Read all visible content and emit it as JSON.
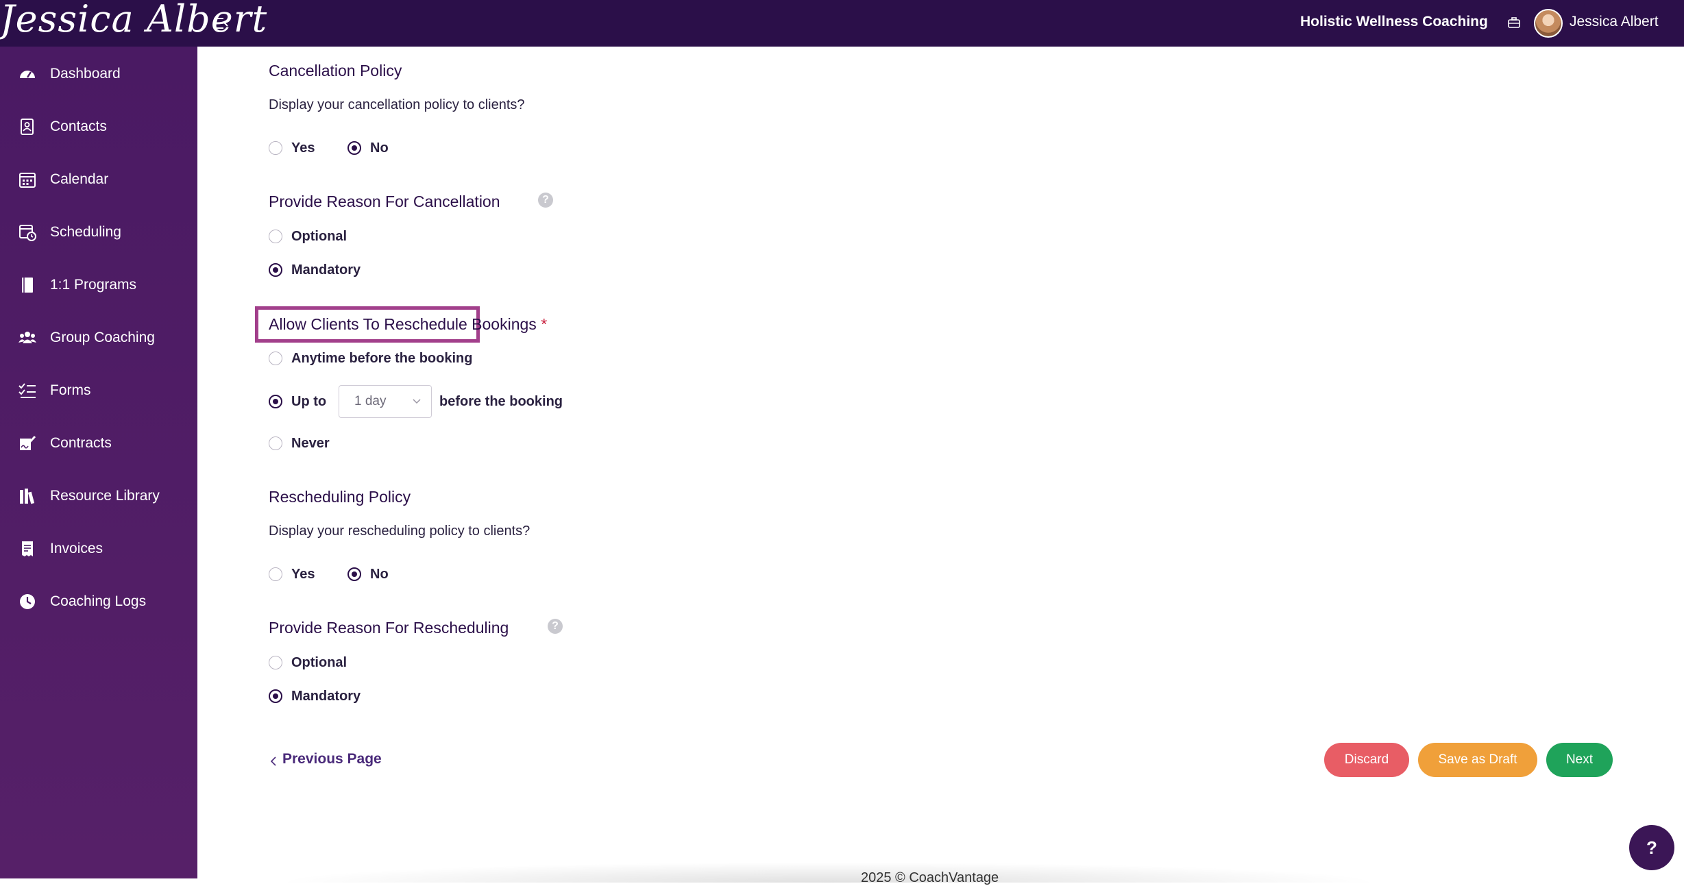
{
  "header": {
    "logo_text": "Jessica Albert",
    "org_name": "Holistic Wellness Coaching",
    "user_name": "Jessica Albert"
  },
  "sidebar": {
    "items": [
      {
        "label": "Dashboard",
        "icon": "dashboard-icon"
      },
      {
        "label": "Contacts",
        "icon": "contacts-icon"
      },
      {
        "label": "Calendar",
        "icon": "calendar-icon"
      },
      {
        "label": "Scheduling",
        "icon": "scheduling-icon"
      },
      {
        "label": "1:1 Programs",
        "icon": "book-icon"
      },
      {
        "label": "Group Coaching",
        "icon": "group-icon"
      },
      {
        "label": "Forms",
        "icon": "checklist-icon"
      },
      {
        "label": "Contracts",
        "icon": "signature-icon"
      },
      {
        "label": "Resource Library",
        "icon": "library-icon"
      },
      {
        "label": "Invoices",
        "icon": "invoice-icon"
      },
      {
        "label": "Coaching Logs",
        "icon": "clock-icon"
      }
    ]
  },
  "cancellation": {
    "title": "Cancellation Policy",
    "question": "Display your cancellation policy to clients?",
    "yes": "Yes",
    "no": "No",
    "selected": "No"
  },
  "cancel_reason": {
    "title": "Provide Reason For Cancellation",
    "optional": "Optional",
    "mandatory": "Mandatory",
    "selected": "Mandatory"
  },
  "reschedule": {
    "title": "Allow Clients To Reschedule Bookings",
    "required_mark": "*",
    "anytime": "Anytime before the booking",
    "up_to": "Up to",
    "up_to_value": "1 day",
    "before": "before the booking",
    "never": "Never",
    "selected": "Up to"
  },
  "rescheduling_policy": {
    "title": "Rescheduling Policy",
    "question": "Display your rescheduling policy to clients?",
    "yes": "Yes",
    "no": "No",
    "selected": "No"
  },
  "reschedule_reason": {
    "title": "Provide Reason For Rescheduling",
    "optional": "Optional",
    "mandatory": "Mandatory",
    "selected": "Mandatory"
  },
  "actions": {
    "previous": "Previous Page",
    "discard": "Discard",
    "save_draft": "Save as Draft",
    "next": "Next"
  },
  "footer": {
    "text": "2025 © CoachVantage"
  },
  "help_fab": "?",
  "help_glyph": "?",
  "colors": {
    "topbar": "#2b0f49",
    "sidebar": "#4a1a63",
    "accent": "#2b0f49",
    "highlight": "#a23f8b",
    "discard": "#e85d65",
    "draft": "#f0a03a",
    "next": "#1fa35a"
  }
}
